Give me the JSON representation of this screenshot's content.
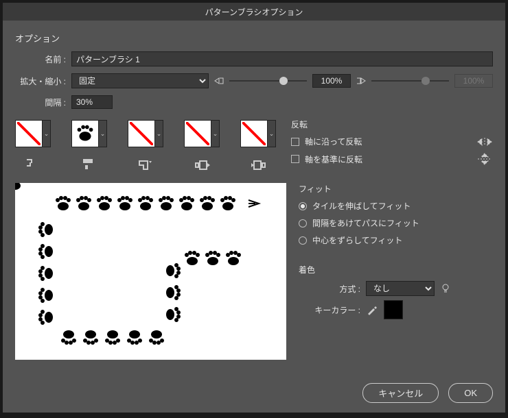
{
  "title": "パターンブラシオプション",
  "options_label": "オプション",
  "name_label": "名前 :",
  "name_value": "パターンブラシ 1",
  "scale_label": "拡大・縮小 :",
  "scale_mode": "固定",
  "scale_percent": "100%",
  "scale_percent_second": "100%",
  "spacing_label": "間隔 :",
  "spacing_value": "30%",
  "flip": {
    "title": "反転",
    "along": "軸に沿って反転",
    "across": "軸を基準に反転"
  },
  "fit": {
    "title": "フィット",
    "stretch": "タイルを伸ばしてフィット",
    "spacing": "間隔をあけてパスにフィット",
    "center": "中心をずらしてフィット",
    "selected": "stretch"
  },
  "colorize": {
    "title": "着色",
    "method_label": "方式 :",
    "method_value": "なし",
    "key_label": "キーカラー :"
  },
  "buttons": {
    "cancel": "キャンセル",
    "ok": "OK"
  }
}
